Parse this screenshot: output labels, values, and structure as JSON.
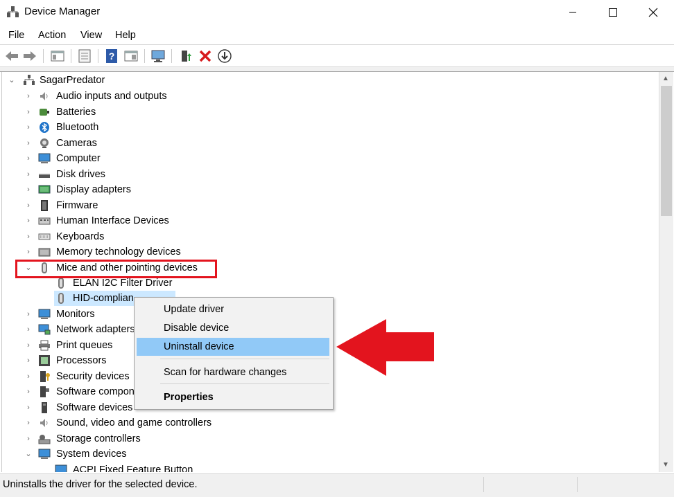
{
  "window": {
    "title": "Device Manager"
  },
  "menu": [
    "File",
    "Action",
    "View",
    "Help"
  ],
  "toolbar_icons": [
    "back-arrow-icon",
    "forward-arrow-icon",
    "show-hide-tree-icon",
    "properties-icon",
    "help-icon",
    "view-icon",
    "monitor-scan-icon",
    "update-driver-icon",
    "uninstall-x-icon",
    "download-driver-icon"
  ],
  "tree": {
    "root": "SagarPredator",
    "categories": [
      {
        "label": "Audio inputs and outputs",
        "icon": "speaker-icon"
      },
      {
        "label": "Batteries",
        "icon": "battery-icon"
      },
      {
        "label": "Bluetooth",
        "icon": "bluetooth-icon"
      },
      {
        "label": "Cameras",
        "icon": "camera-icon"
      },
      {
        "label": "Computer",
        "icon": "computer-icon"
      },
      {
        "label": "Disk drives",
        "icon": "disk-drive-icon"
      },
      {
        "label": "Display adapters",
        "icon": "display-adapter-icon"
      },
      {
        "label": "Firmware",
        "icon": "firmware-icon"
      },
      {
        "label": "Human Interface Devices",
        "icon": "hid-icon"
      },
      {
        "label": "Keyboards",
        "icon": "keyboard-icon"
      },
      {
        "label": "Memory technology devices",
        "icon": "memory-icon"
      },
      {
        "label": "Mice and other pointing devices",
        "icon": "mouse-icon"
      }
    ],
    "mice_children": [
      "ELAN I2C Filter Driver",
      "HID-complian"
    ],
    "categories_after": [
      {
        "label": "Monitors",
        "icon": "monitor-icon"
      },
      {
        "label": "Network adapters",
        "icon": "network-icon"
      },
      {
        "label": "Print queues",
        "icon": "printer-icon"
      },
      {
        "label": "Processors",
        "icon": "processor-icon"
      },
      {
        "label": "Security devices",
        "icon": "security-icon"
      },
      {
        "label": "Software compon",
        "icon": "software-component-icon"
      },
      {
        "label": "Software devices",
        "icon": "software-device-icon"
      },
      {
        "label": "Sound, video and game controllers",
        "icon": "sound-icon"
      },
      {
        "label": "Storage controllers",
        "icon": "storage-icon"
      },
      {
        "label": "System devices",
        "icon": "system-icon"
      }
    ],
    "system_child": "ACPI Fixed Feature Button"
  },
  "context_menu": {
    "items": [
      "Update driver",
      "Disable device",
      "Uninstall device",
      "Scan for hardware changes",
      "Properties"
    ],
    "highlighted": "Uninstall device"
  },
  "status": {
    "text": "Uninstalls the driver for the selected device."
  },
  "colors": {
    "highlight_box": "#e3141e",
    "arrow": "#e3141e",
    "menu_highlight": "#91c9f7",
    "selection": "#cce8ff"
  }
}
